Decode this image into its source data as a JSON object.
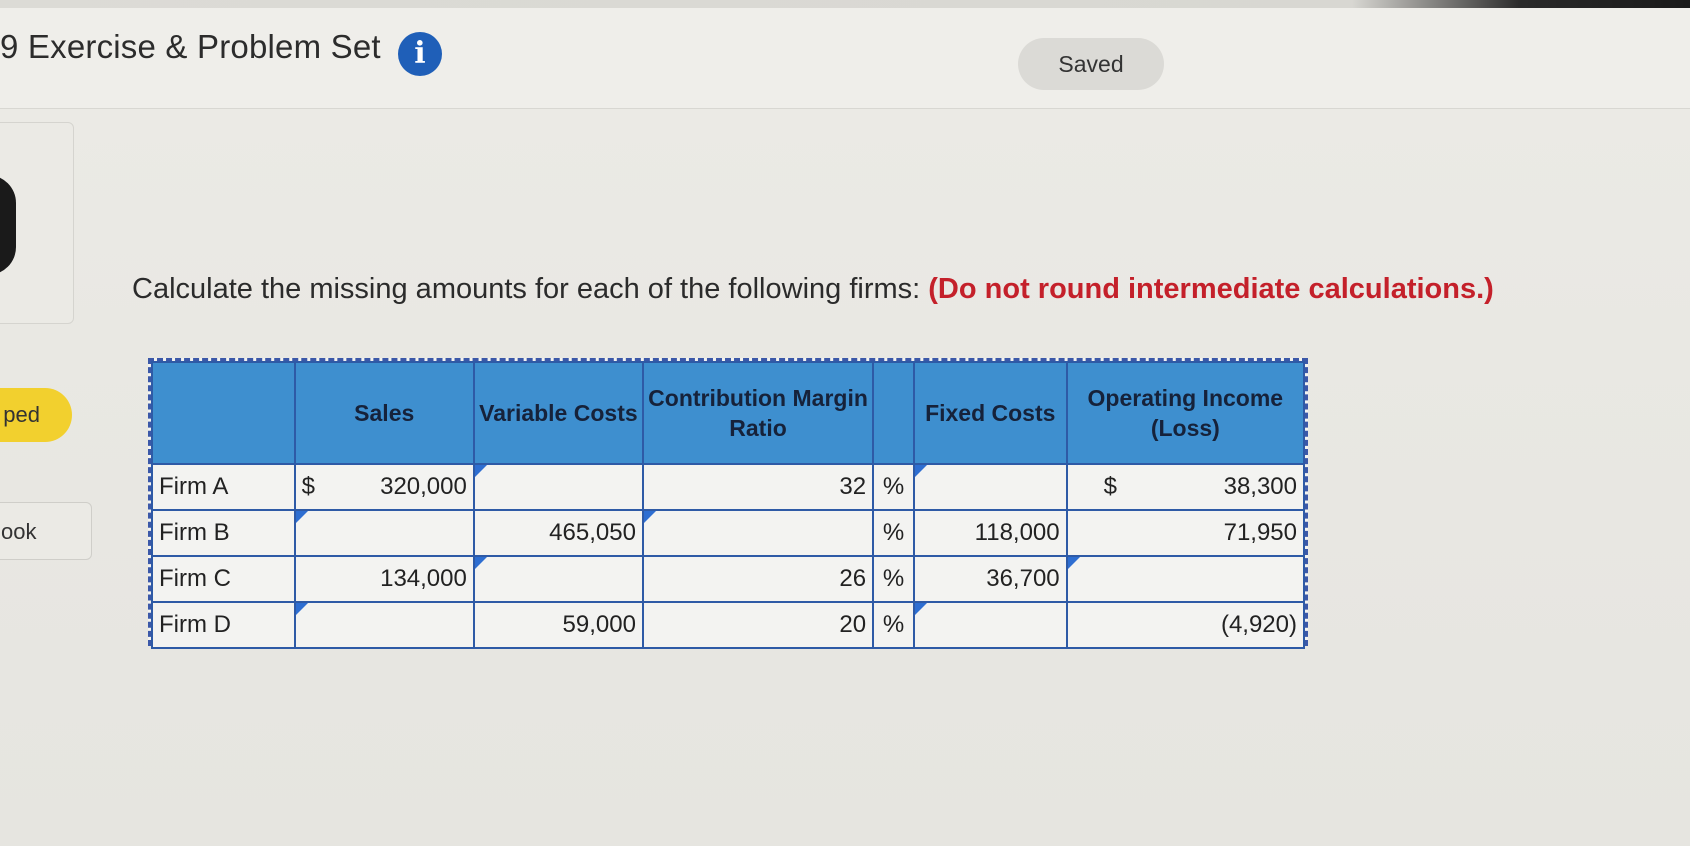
{
  "header": {
    "title": "9 Exercise & Problem Set",
    "status": "Saved"
  },
  "sidebar": {
    "badge_label": "ped",
    "ebook_label": "ook"
  },
  "instruction": {
    "text": "Calculate the missing amounts for each of the following firms:",
    "note": "(Do not round intermediate calculations.)"
  },
  "table": {
    "headers": {
      "sales": "Sales",
      "variable_costs": "Variable Costs",
      "cm_ratio": "Contribution Margin Ratio",
      "fixed_costs": "Fixed Costs",
      "operating_income": "Operating Income (Loss)"
    },
    "currency_symbol": "$",
    "percent_symbol": "%",
    "rows": [
      {
        "firm": "Firm A",
        "sales": "320,000",
        "variable_costs": "",
        "cm_ratio": "32",
        "fixed_costs": "",
        "operating_income": "38,300"
      },
      {
        "firm": "Firm B",
        "sales": "",
        "variable_costs": "465,050",
        "cm_ratio": "",
        "fixed_costs": "118,000",
        "operating_income": "71,950"
      },
      {
        "firm": "Firm C",
        "sales": "134,000",
        "variable_costs": "",
        "cm_ratio": "26",
        "fixed_costs": "36,700",
        "operating_income": ""
      },
      {
        "firm": "Firm D",
        "sales": "",
        "variable_costs": "59,000",
        "cm_ratio": "20",
        "fixed_costs": "",
        "operating_income": "(4,920)"
      }
    ]
  },
  "colors": {
    "header_fill": "#3e8fcf",
    "grid_border": "#2e5aa6",
    "note_red": "#c4202a",
    "info_blue": "#1f5fb8",
    "badge_yellow": "#f2d02e"
  }
}
